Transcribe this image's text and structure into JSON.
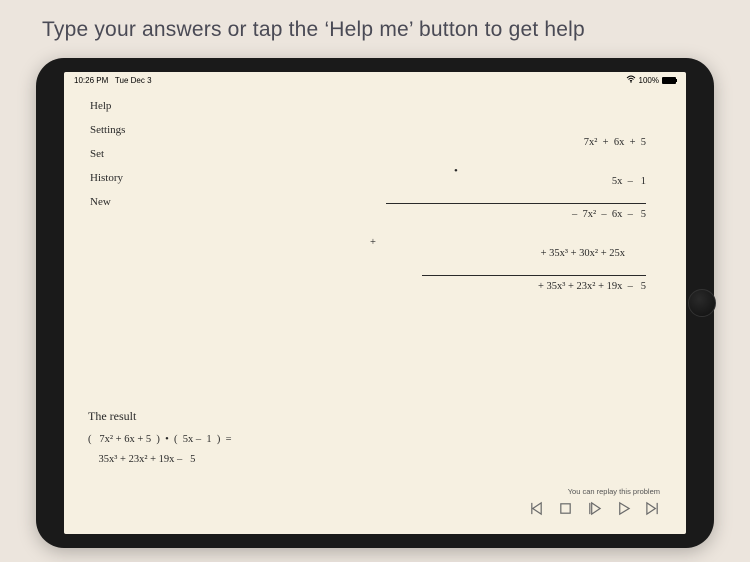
{
  "caption": "Type your answers or tap the ‘Help me’ button to get help",
  "status": {
    "time": "10:26 PM",
    "date": "Tue Dec 3",
    "battery": "100%"
  },
  "menu": [
    "Help",
    "Settings",
    "Set",
    "History",
    "New"
  ],
  "work": {
    "line1": "7x²  +  6x  +  5",
    "line2": "5x  –   1",
    "line3": "–  7x²  –  6x  –   5",
    "line4": "+ 35x³ + 30x² + 25x        ",
    "line5": "+ 35x³ + 23x² + 19x  –   5"
  },
  "result": {
    "title": "The result",
    "problem": "(   7x² + 6x + 5  )  •  (  5x –  1  )  =",
    "answer": "    35x³ + 23x² + 19x –   5"
  },
  "replay": "You can replay this problem"
}
